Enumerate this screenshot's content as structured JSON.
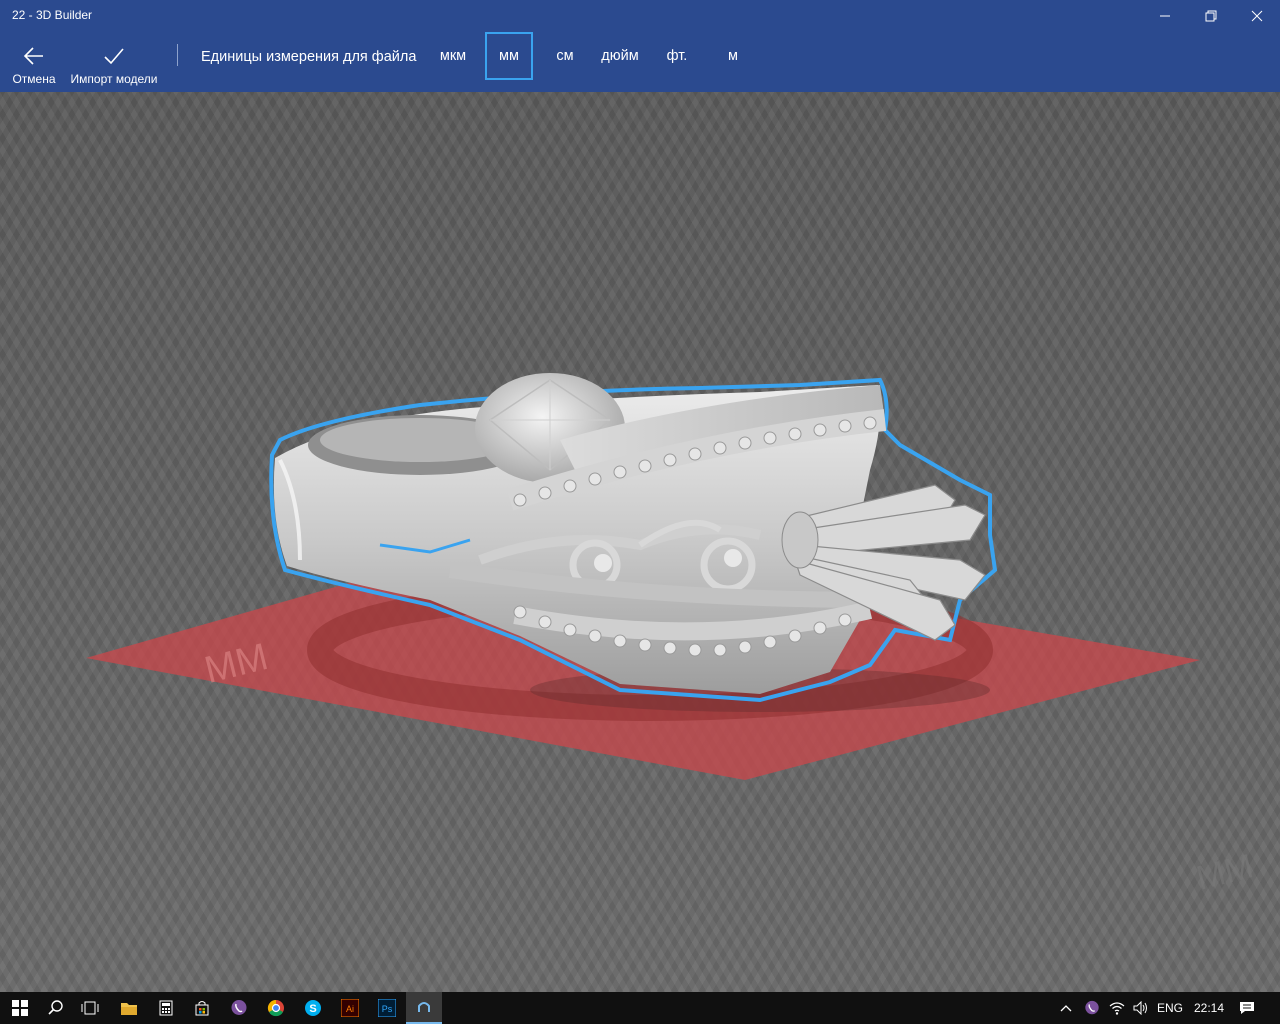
{
  "window": {
    "title": "22 - 3D Builder"
  },
  "ribbon": {
    "cancel_label": "Отмена",
    "import_label": "Импорт модели",
    "units_label": "Единицы измерения для файла",
    "units": [
      "мкм",
      "мм",
      "см",
      "дюйм",
      "фт.",
      "м"
    ],
    "selected_unit": "мм"
  },
  "viewport": {
    "model": "ring",
    "selection_color": "#3aa3ef",
    "plate_color": "#c8484b"
  },
  "taskbar": {
    "language": "ENG",
    "time": "22:14"
  }
}
